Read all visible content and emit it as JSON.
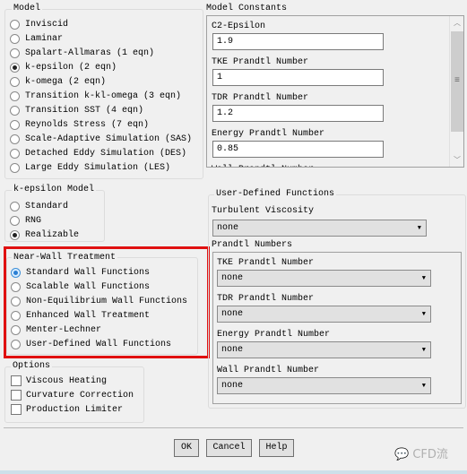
{
  "model": {
    "title": "Model",
    "options": [
      "Inviscid",
      "Laminar",
      "Spalart-Allmaras (1 eqn)",
      "k-epsilon (2 eqn)",
      "k-omega (2 eqn)",
      "Transition k-kl-omega (3 eqn)",
      "Transition SST (4 eqn)",
      "Reynolds Stress (7 eqn)",
      "Scale-Adaptive Simulation (SAS)",
      "Detached Eddy Simulation (DES)",
      "Large Eddy Simulation (LES)"
    ],
    "selected": "k-epsilon (2 eqn)"
  },
  "constants": {
    "title": "Model Constants",
    "fields": [
      {
        "label": "C2-Epsilon",
        "value": "1.9"
      },
      {
        "label": "TKE Prandtl Number",
        "value": "1"
      },
      {
        "label": "TDR Prandtl Number",
        "value": "1.2"
      },
      {
        "label": "Energy Prandtl Number",
        "value": "0.85"
      },
      {
        "label": "Wall Prandtl Number"
      }
    ]
  },
  "kepsilon": {
    "title": "k-epsilon Model",
    "options": [
      "Standard",
      "RNG",
      "Realizable"
    ],
    "selected": "Realizable"
  },
  "nearwall": {
    "title": "Near-Wall Treatment",
    "options": [
      "Standard Wall Functions",
      "Scalable Wall Functions",
      "Non-Equilibrium Wall Functions",
      "Enhanced Wall Treatment",
      "Menter-Lechner",
      "User-Defined Wall Functions"
    ],
    "selected": "Standard Wall Functions",
    "highlight_color": "#e01010"
  },
  "options": {
    "title": "Options",
    "items": [
      {
        "label": "Viscous Heating",
        "checked": false
      },
      {
        "label": "Curvature Correction",
        "checked": false
      },
      {
        "label": "Production Limiter",
        "checked": false
      }
    ]
  },
  "udf": {
    "title": "User-Defined Functions",
    "turb_visc_label": "Turbulent Viscosity",
    "turb_visc_value": "none",
    "prandtl_title": "Prandtl Numbers",
    "prandtl": [
      {
        "label": "TKE Prandtl Number",
        "value": "none"
      },
      {
        "label": "TDR Prandtl Number",
        "value": "none"
      },
      {
        "label": "Energy Prandtl Number",
        "value": "none"
      },
      {
        "label": "Wall Prandtl Number",
        "value": "none"
      }
    ]
  },
  "buttons": {
    "ok": "OK",
    "cancel": "Cancel",
    "help": "Help"
  },
  "watermark": "CFD流"
}
